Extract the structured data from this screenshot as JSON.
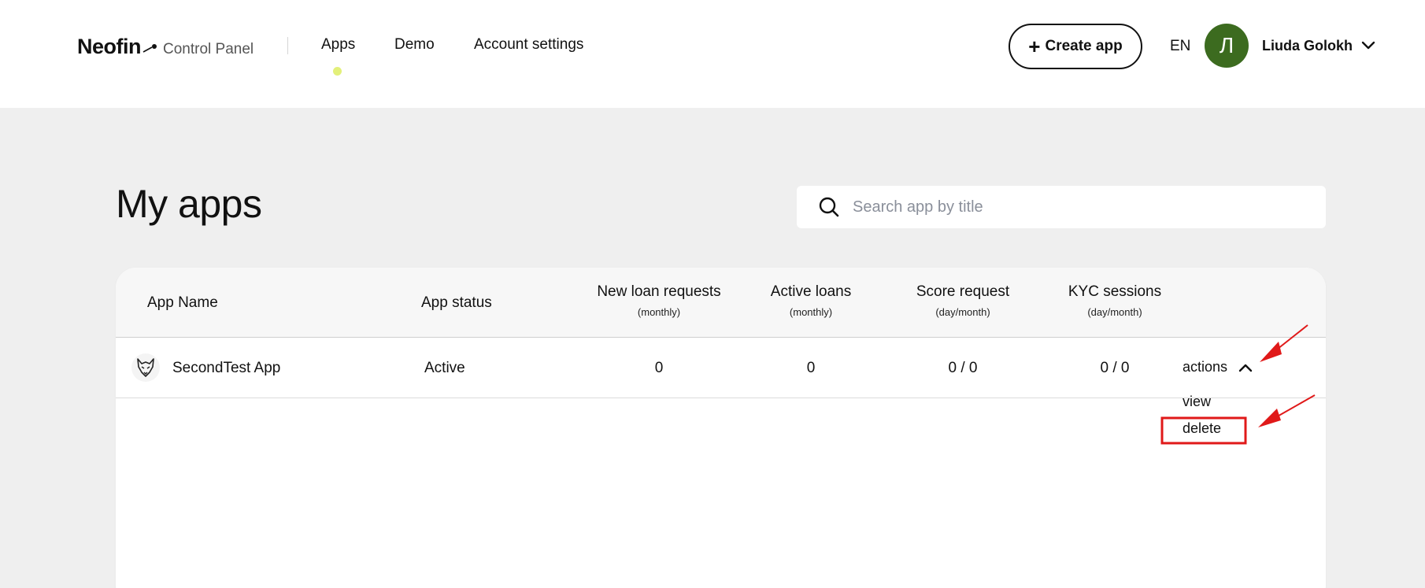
{
  "header": {
    "logo_text": "Neofin",
    "logo_subtitle": "Control Panel",
    "nav": [
      {
        "label": "Apps",
        "active": true
      },
      {
        "label": "Demo",
        "active": false
      },
      {
        "label": "Account settings",
        "active": false
      }
    ],
    "create_label": "Create app",
    "language": "EN",
    "avatar_initial": "Л",
    "user_name": "Liuda Golokh"
  },
  "main": {
    "title": "My apps",
    "search_placeholder": "Search app by title"
  },
  "table": {
    "columns": [
      {
        "label": "App Name",
        "sub": ""
      },
      {
        "label": "App status",
        "sub": ""
      },
      {
        "label": "New loan requests",
        "sub": "(monthly)"
      },
      {
        "label": "Active loans",
        "sub": "(monthly)"
      },
      {
        "label": "Score request",
        "sub": "(day/month)"
      },
      {
        "label": "KYC sessions",
        "sub": "(day/month)"
      }
    ],
    "rows": [
      {
        "name": "SecondTest App",
        "status": "Active",
        "new_loan_requests": "0",
        "active_loans": "0",
        "score_request": "0 / 0",
        "kyc_sessions": "0 / 0",
        "actions_label": "actions"
      }
    ]
  },
  "actions_menu": {
    "items": [
      {
        "label": "view"
      },
      {
        "label": "delete"
      }
    ]
  },
  "colors": {
    "accent_dot": "#e3f07a",
    "avatar_bg": "#3c6b1f",
    "annotation_red": "#e01919"
  }
}
